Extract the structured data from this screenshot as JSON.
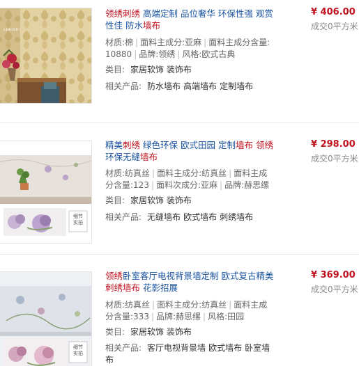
{
  "items": [
    {
      "title_parts": [
        {
          "text": "领绣刺绣",
          "hl": true
        },
        {
          "text": " 高端定制 品位奢华 环保性强 观赏性佳 防水",
          "hl": false
        },
        {
          "text": "墙布",
          "hl": true
        }
      ],
      "attrs": [
        "材质:棉",
        "面料主成分:亚麻",
        "面料主成分含量:10880",
        "品牌:领绣",
        "风格:欧式古典"
      ],
      "category_label": "类目:",
      "category_value": "家居软饰 装饰布",
      "related_label": "相关产品:",
      "related": [
        "防水墙布",
        "高端墙布",
        "定制墙布"
      ],
      "price": "¥ 406.00",
      "sold": "成交0平方米"
    },
    {
      "title_parts": [
        {
          "text": "精美",
          "hl": false
        },
        {
          "text": "刺绣",
          "hl": true
        },
        {
          "text": " 绿色环保 欧式田园 定制",
          "hl": false
        },
        {
          "text": "墙布",
          "hl": true
        },
        {
          "text": " ",
          "hl": false
        },
        {
          "text": "领绣",
          "hl": true
        },
        {
          "text": " 环保无缝",
          "hl": false
        },
        {
          "text": "墙布",
          "hl": true
        }
      ],
      "attrs": [
        "材质:纺真丝",
        "面料主成分:纺真丝",
        "面料主成分含量:123",
        "面料次成分:亚麻",
        "品牌:赫思缧"
      ],
      "category_label": "类目:",
      "category_value": "家居软饰 装饰布",
      "related_label": "相关产品:",
      "related": [
        "无缝墙布",
        "欧式墙布",
        "刺绣墙布"
      ],
      "price": "¥ 298.00",
      "sold": "成交0平方米"
    },
    {
      "title_parts": [
        {
          "text": "领绣",
          "hl": true
        },
        {
          "text": "卧室客厅电视背景墙定制 欧式复古精美",
          "hl": false
        },
        {
          "text": "刺绣墙布",
          "hl": true
        },
        {
          "text": " 花影招展",
          "hl": false
        }
      ],
      "attrs": [
        "材质:纺真丝",
        "面料主成分:纺真丝",
        "面料主成分含量:333",
        "品牌:赫思缧",
        "风格:田园"
      ],
      "category_label": "类目:",
      "category_value": "家居软饰 装饰布",
      "related_label": "相关产品:",
      "related": [
        "客厅电视背景墙",
        "欧式墙布",
        "卧室墙布"
      ],
      "price": "¥ 369.00",
      "sold": "成交0平方米"
    }
  ],
  "thumb_badge": [
    "细节",
    "实拍"
  ],
  "colors": {
    "accent": "#c1121f",
    "link": "#1a53a0"
  }
}
